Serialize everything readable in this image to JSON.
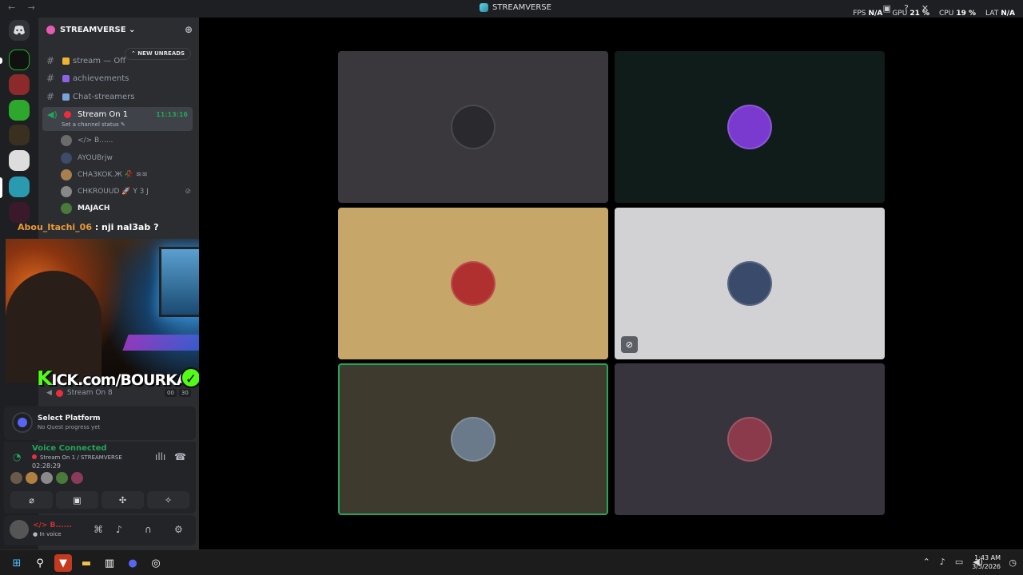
{
  "titlebar": {
    "title": "STREAMVERSE",
    "nav": "← →"
  },
  "stats": [
    {
      "label": "FPS",
      "value": "N/A"
    },
    {
      "label": "GPU",
      "value": "21 %"
    },
    {
      "label": "CPU",
      "value": "19 %"
    },
    {
      "label": "LAT",
      "value": "N/A"
    }
  ],
  "server": {
    "name": "STREAMVERSE ⌄"
  },
  "unreads_label": "⌃ NEW UNREADS",
  "channels": [
    {
      "name": "stream — Off",
      "color": "#f0b232"
    },
    {
      "name": "achievements",
      "color": "#8a63e8"
    },
    {
      "name": "Chat-streamers",
      "color": "#7aa3d9"
    }
  ],
  "voice_channel": {
    "name": "Stream On 1",
    "status": "Set a channel status ✎",
    "time": "11:13:16"
  },
  "voice_users": [
    {
      "name": "</> B......",
      "color": "#6b6b6b"
    },
    {
      "name": "AYOUBrjw",
      "color": "#3d4a6a"
    },
    {
      "name": "CHA3KOK.Ж 🥀 ≋≋",
      "color": "#a88050"
    },
    {
      "name": "CHKROUUD 🚀 Y 3 J",
      "color": "#888888"
    },
    {
      "name": "MAJACH",
      "color": "#4a7a3a"
    }
  ],
  "chat": {
    "user": "Abou_Itachi_06",
    "text": ": nji nal3ab ?"
  },
  "kick": {
    "k": "K",
    "rest": "ICK.com/BOURKABIXX",
    "check": "✓"
  },
  "channel8": {
    "name": "Stream On 8",
    "tag1": "00",
    "tag2": "30"
  },
  "quest": {
    "title": "Select Platform",
    "sub": "No Quest progress yet"
  },
  "voice_panel": {
    "title": "Voice Connected",
    "sub": "Stream On 1 / STREAMVERSE",
    "duration": "02:28:29",
    "avatars": [
      "#6a5a4a",
      "#b08040",
      "#8a8a8a",
      "#4a7a3a",
      "#8a3a5a"
    ],
    "buttons": [
      "⌀",
      "▣",
      "✣",
      "✧"
    ]
  },
  "userbar": {
    "name": "</> B......",
    "status": "In voice"
  },
  "tiles": [
    {
      "bg": "#3a383c",
      "av": "#2a2a2e",
      "border": "none",
      "muted": false
    },
    {
      "bg": "#0f1c1a",
      "av": "#7a3ad0",
      "border": "none",
      "muted": false
    },
    {
      "bg": "#c7a66a",
      "av": "#b03030",
      "border": "none",
      "muted": false
    },
    {
      "bg": "#d2d2d4",
      "av": "#3a4a6a",
      "border": "none",
      "muted": true
    },
    {
      "bg": "#3e3b2e",
      "av": "#6a7a8a",
      "border": "#23a55a",
      "muted": false
    },
    {
      "bg": "#38343e",
      "av": "#8a3a4a",
      "border": "none",
      "muted": false
    }
  ],
  "clock": {
    "time": "1:43 AM",
    "date": "3/5/2026"
  }
}
